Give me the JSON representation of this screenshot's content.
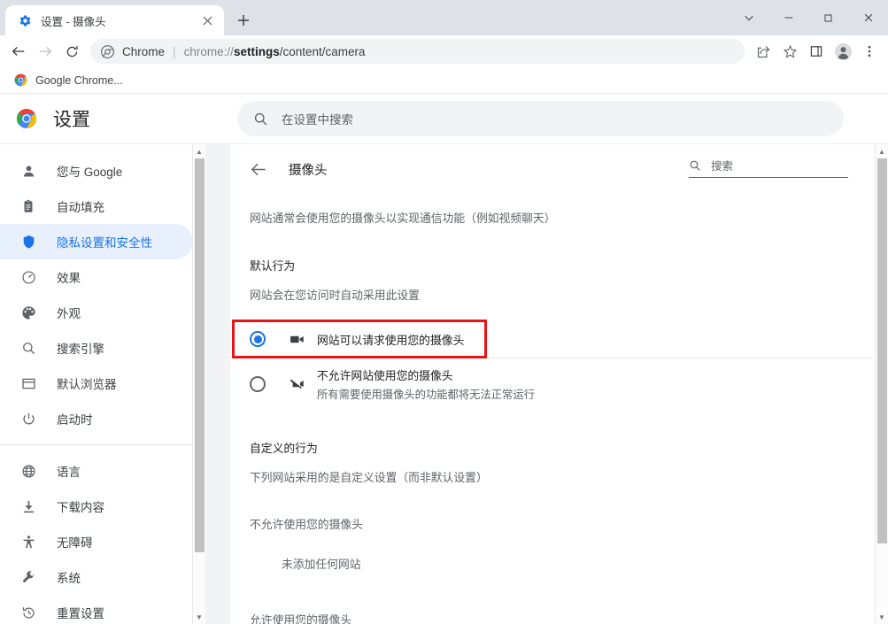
{
  "browser": {
    "tab": {
      "title": "设置 - 摄像头",
      "favicon": "gear-icon",
      "close": "×"
    },
    "newtab_label": "+",
    "window_controls": {
      "chevron": "⌄",
      "minimize": "—",
      "maximize": "▢",
      "close": "✕"
    },
    "nav": {
      "back": "←",
      "forward": "→",
      "reload": "⟳"
    },
    "omnibox": {
      "site_label": "Chrome",
      "separator": "|",
      "url_scheme": "chrome://",
      "url_host": "settings",
      "url_path": "/content/camera"
    },
    "toolbar_icons": [
      "share-icon",
      "bookmark-star-icon",
      "side-panel-icon",
      "profile-icon",
      "more-menu-icon"
    ],
    "bookmarks": [
      {
        "label": "Google Chrome...",
        "icon": "chrome-logo-icon"
      }
    ]
  },
  "settings": {
    "title": "设置",
    "search_placeholder": "在设置中搜索",
    "sidebar": {
      "group1": [
        {
          "label": "您与 Google",
          "icon": "person-icon",
          "active": false
        },
        {
          "label": "自动填充",
          "icon": "clipboard-icon",
          "active": false
        },
        {
          "label": "隐私设置和安全性",
          "icon": "shield-icon",
          "active": true
        },
        {
          "label": "效果",
          "icon": "speedometer-icon",
          "active": false
        },
        {
          "label": "外观",
          "icon": "palette-icon",
          "active": false
        },
        {
          "label": "搜索引擎",
          "icon": "search-icon",
          "active": false
        },
        {
          "label": "默认浏览器",
          "icon": "browser-window-icon",
          "active": false
        },
        {
          "label": "启动时",
          "icon": "power-icon",
          "active": false
        }
      ],
      "group2": [
        {
          "label": "语言",
          "icon": "globe-icon",
          "active": false
        },
        {
          "label": "下载内容",
          "icon": "download-icon",
          "active": false
        },
        {
          "label": "无障碍",
          "icon": "accessibility-icon",
          "active": false
        },
        {
          "label": "系统",
          "icon": "wrench-icon",
          "active": false
        },
        {
          "label": "重置设置",
          "icon": "history-restore-icon",
          "active": false
        }
      ]
    },
    "content": {
      "page_title": "摄像头",
      "back_icon": "back-arrow-icon",
      "search_placeholder": "搜索",
      "description": "网站通常会使用您的摄像头以实现通信功能（例如视频聊天）",
      "default_behavior": {
        "heading": "默认行为",
        "subheading": "网站会在您访问时自动采用此设置",
        "options": [
          {
            "label": "网站可以请求使用您的摄像头",
            "sub": "",
            "icon": "camera-on-icon",
            "selected": true,
            "highlighted": true
          },
          {
            "label": "不允许网站使用您的摄像头",
            "sub": "所有需要使用摄像头的功能都将无法正常运行",
            "icon": "camera-off-icon",
            "selected": false,
            "highlighted": false
          }
        ]
      },
      "custom_behavior": {
        "heading": "自定义的行为",
        "subheading": "下列网站采用的是自定义设置（而非默认设置）",
        "blocked_heading": "不允许使用您的摄像头",
        "blocked_empty": "未添加任何网站",
        "allowed_heading": "允许使用您的摄像头"
      }
    },
    "accent_color": "#1a73e8",
    "highlight_color": "#e81416"
  }
}
